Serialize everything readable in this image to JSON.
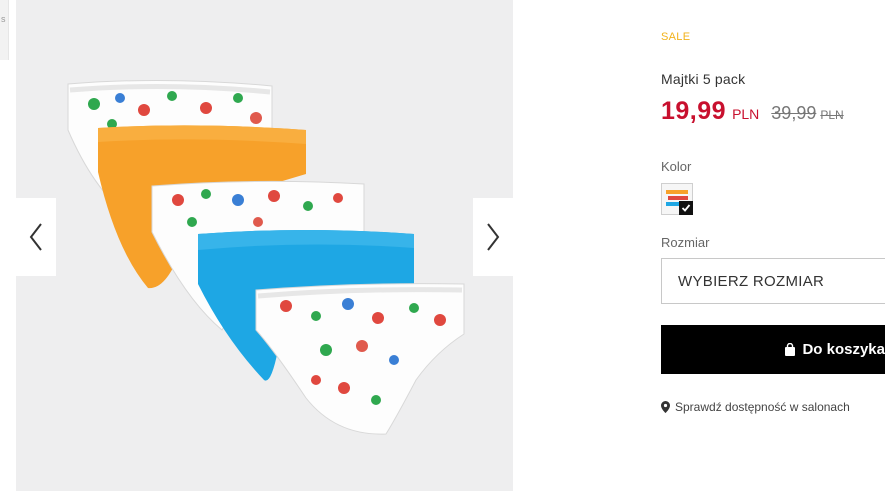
{
  "left_strip_glyph": "s",
  "product": {
    "sale_badge": "SALE",
    "name": "Majtki 5 pack",
    "price": {
      "current": "19,99",
      "current_currency": "PLN",
      "old": "39,99",
      "old_currency": "PLN"
    },
    "color_label": "Kolor",
    "size_label": "Rozmiar",
    "size_select_placeholder": "WYBIERZ ROZMIAR",
    "add_to_cart": "Do koszyka",
    "store_check": "Sprawdź dostępność w salonach"
  },
  "colors": {
    "sale": "#f2b21b",
    "price": "#c8102e",
    "button": "#000000",
    "orange_brief": "#f7a12a",
    "blue_brief": "#1ea7e4"
  },
  "icons": {
    "prev": "chevron-left-icon",
    "next": "chevron-right-icon",
    "swatch_check": "check-icon",
    "bag": "shopping-bag-icon",
    "location": "map-pin-icon"
  }
}
